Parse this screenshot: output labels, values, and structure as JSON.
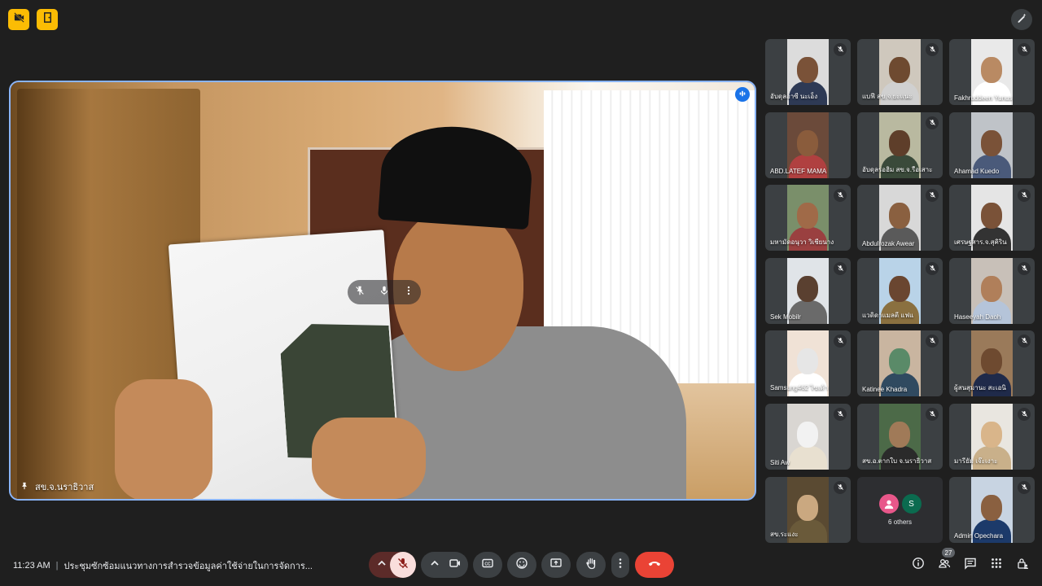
{
  "top_bar": {
    "left_icons": [
      "camera-off-icon",
      "door-exit-icon"
    ],
    "right_icon": "pencil-sparkle-icon"
  },
  "main_tile": {
    "participant_name": "สข.จ.นราธิวาส",
    "pinned": true,
    "speaking": true
  },
  "tiles": [
    {
      "name": "อับดุลอาซี นะเอ็ง",
      "muted": true
    },
    {
      "name": "แบฟี สข.จ.ยะแนะ",
      "muted": true
    },
    {
      "name": "Fakhruddeen Yunus",
      "muted": true
    },
    {
      "name": "ABD.LATEF MAMA",
      "muted": false
    },
    {
      "name": "อับดุลรอฮิม สข.จ.รือเสาะ",
      "muted": true
    },
    {
      "name": "Ahamad Kuedo",
      "muted": false
    },
    {
      "name": "มหามัดอนุวา วิเชียนาง",
      "muted": true
    },
    {
      "name": "Abdulrozak Awear",
      "muted": true
    },
    {
      "name": "เศรษฐสาร.จ.สุคิริน",
      "muted": true
    },
    {
      "name": "Sek Mobilr",
      "muted": true
    },
    {
      "name": "แวดิดาแมลตี แฟแ",
      "muted": true
    },
    {
      "name": "Haseeyah Daoh",
      "muted": true
    },
    {
      "name": "Samsung462 ไซเด้า",
      "muted": true
    },
    {
      "name": "Katinee Khadra",
      "muted": true
    },
    {
      "name": "ผู้สนสุมานะ สะเอนิ",
      "muted": true
    },
    {
      "name": "Siti Aw",
      "muted": true
    },
    {
      "name": "สข.อ.ตากใบ จ.นราธิวาส",
      "muted": true
    },
    {
      "name": "มารียัม เจ๊ะเงาะ",
      "muted": true
    },
    {
      "name": "สข.ระแงะ",
      "muted": true
    },
    {
      "name": "Admin Opechara",
      "muted": true
    }
  ],
  "others": {
    "label": "6 others",
    "avatar_letter": "S"
  },
  "bottom_bar": {
    "time": "11:23 AM",
    "separator": "|",
    "meeting_title": "ประชุมซักซ้อมแนวทางการสำรวจข้อมูลค่าใช้จ่ายในการจัดการ...",
    "participants_count": "27"
  },
  "colors": {
    "background": "#1f1f1f",
    "accent_yellow": "#fbbc04",
    "mic_off_red": "#f28b82",
    "end_call": "#ea4335",
    "active_border": "#8ab4f8"
  }
}
